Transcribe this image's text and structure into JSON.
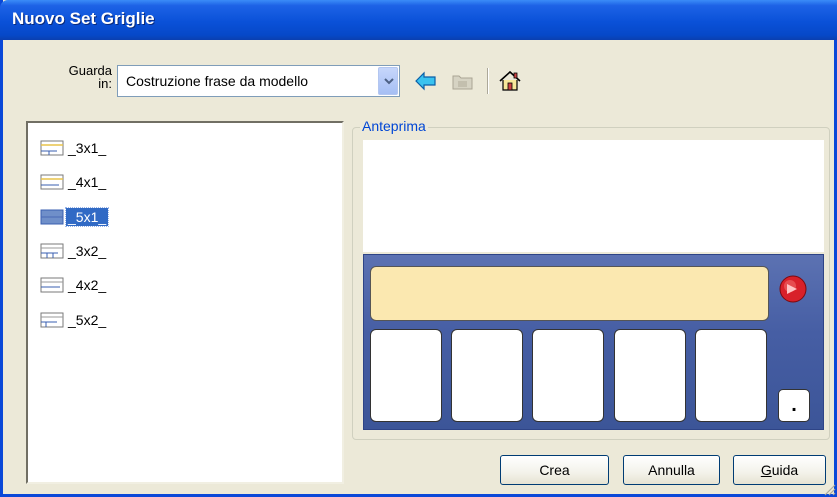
{
  "window": {
    "title": "Nuovo Set Griglie"
  },
  "look_in": {
    "label_line1": "Guarda",
    "label_line2": "in:",
    "selected_folder": "Costruzione frase da modello"
  },
  "toolbar": {
    "back_icon": "back-arrow-icon",
    "up_icon": "folder-up-icon",
    "home_icon": "home-icon"
  },
  "file_list": {
    "items": [
      {
        "label": "_3x1_",
        "selected": false
      },
      {
        "label": "_4x1_",
        "selected": false
      },
      {
        "label": "_5x1_",
        "selected": true
      },
      {
        "label": "_3x2_",
        "selected": false
      },
      {
        "label": "_4x2_",
        "selected": false
      },
      {
        "label": "_5x2_",
        "selected": false
      }
    ]
  },
  "preview": {
    "legend": "Anteprima",
    "period_symbol": ".",
    "sentence_bar_color": "#fbe8b0",
    "panel_color": "#465ea4",
    "speak_icon": "speak-red-icon"
  },
  "buttons": {
    "create": "Crea",
    "cancel": "Annulla",
    "help_accel": "G",
    "help_rest": "uida"
  },
  "colors": {
    "title_bar": "#0a51d8",
    "selection": "#316ac5",
    "group_label": "#0046d5"
  }
}
